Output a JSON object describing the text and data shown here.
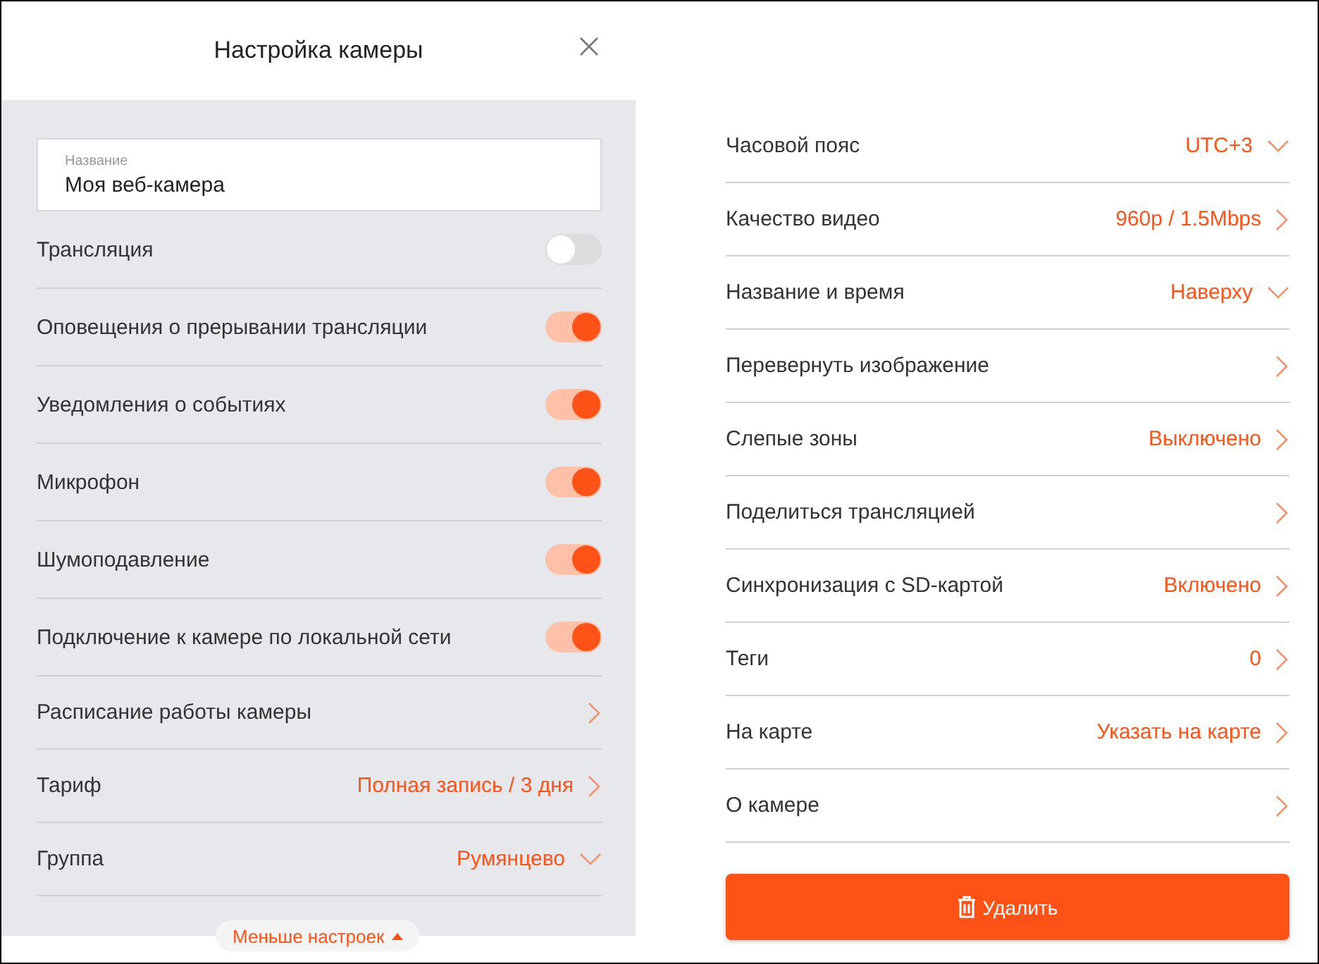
{
  "dialog": {
    "title": "Настройка камеры"
  },
  "name_field": {
    "label": "Название",
    "value": "Моя веб-камера"
  },
  "left_settings": [
    {
      "kind": "toggle",
      "label": "Трансляция",
      "on": false
    },
    {
      "kind": "toggle",
      "label": "Оповещения о прерывании трансляции",
      "on": true
    },
    {
      "kind": "toggle",
      "label": "Уведомления о событиях",
      "on": true
    },
    {
      "kind": "toggle",
      "label": "Микрофон",
      "on": true
    },
    {
      "kind": "toggle",
      "label": "Шумоподавление",
      "on": true
    },
    {
      "kind": "toggle",
      "label": "Подключение к камере по локальной сети",
      "on": true
    },
    {
      "kind": "link",
      "label": "Расписание работы камеры"
    },
    {
      "kind": "link",
      "label": "Тариф",
      "value": "Полная запись / 3 дня"
    },
    {
      "kind": "select",
      "label": "Группа",
      "value": "Румянцево"
    }
  ],
  "less_settings_button": {
    "label": "Меньше настроек"
  },
  "right_settings": [
    {
      "kind": "select",
      "label": "Часовой пояс",
      "value": "UTC+3"
    },
    {
      "kind": "link",
      "label": "Качество видео",
      "value": "960p / 1.5Mbps"
    },
    {
      "kind": "select",
      "label": "Название и время",
      "value": "Наверху"
    },
    {
      "kind": "link",
      "label": "Перевернуть изображение"
    },
    {
      "kind": "link",
      "label": "Слепые зоны",
      "value": "Выключено"
    },
    {
      "kind": "link",
      "label": "Поделиться трансляцией"
    },
    {
      "kind": "link",
      "label": "Синхронизация с SD-картой",
      "value": "Включено"
    },
    {
      "kind": "link",
      "label": "Теги",
      "value": "0"
    },
    {
      "kind": "link",
      "label": "На карте",
      "value": "Указать на карте"
    },
    {
      "kind": "link",
      "label": "О камере"
    }
  ],
  "delete_button": {
    "label": "Удалить"
  }
}
